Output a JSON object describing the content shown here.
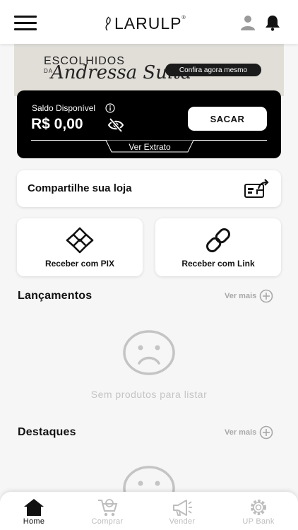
{
  "header": {
    "logo_text": "LARULP",
    "logo_reg": "®"
  },
  "banner": {
    "line1": "ESCOLHIDOS",
    "line2": "DA",
    "script": "Andressa Suita",
    "cta": "Confira agora mesmo"
  },
  "balance": {
    "label": "Saldo Disponível",
    "value": "R$ 0,00",
    "withdraw_label": "SACAR",
    "statement_label": "Ver Extrato"
  },
  "share": {
    "label": "Compartilhe sua loja"
  },
  "actions": {
    "pix_label": "Receber com PIX",
    "link_label": "Receber com Link"
  },
  "launches": {
    "title": "Lançamentos",
    "see_more": "Ver mais",
    "empty_text": "Sem produtos para listar"
  },
  "highlights": {
    "title": "Destaques",
    "see_more": "Ver mais"
  },
  "nav": {
    "items": [
      {
        "label": "Home",
        "icon": "home-icon",
        "active": true
      },
      {
        "label": "Comprar",
        "icon": "cart-icon",
        "active": false
      },
      {
        "label": "Vender",
        "icon": "megaphone-icon",
        "active": false
      },
      {
        "label": "UP Bank",
        "icon": "gear-icon",
        "active": false
      }
    ]
  },
  "colors": {
    "background": "#f6f6f6",
    "card": "#ffffff",
    "balance_card": "#000000",
    "muted_text": "#a8a8a8",
    "empty_text": "#c4c4c4",
    "nav_inactive": "#bdbdbd"
  }
}
